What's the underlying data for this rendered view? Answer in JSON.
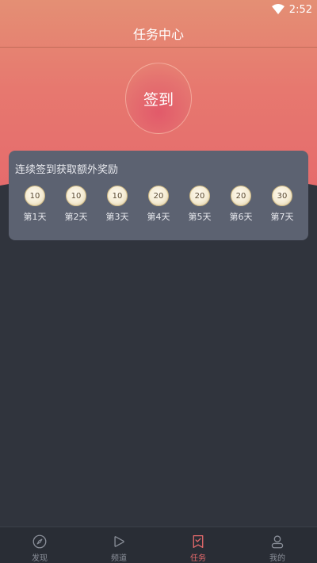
{
  "status_bar": {
    "time": "2:52"
  },
  "header": {
    "title": "任务中心"
  },
  "checkin": {
    "button_label": "签到"
  },
  "card": {
    "title": "连续签到获取额外奖励",
    "days": [
      {
        "reward": "10",
        "label": "第1天"
      },
      {
        "reward": "10",
        "label": "第2天"
      },
      {
        "reward": "10",
        "label": "第3天"
      },
      {
        "reward": "20",
        "label": "第4天"
      },
      {
        "reward": "20",
        "label": "第5天"
      },
      {
        "reward": "20",
        "label": "第6天"
      },
      {
        "reward": "30",
        "label": "第7天"
      }
    ]
  },
  "bottom_nav": {
    "items": [
      {
        "label": "发现",
        "icon": "compass-icon",
        "active": false
      },
      {
        "label": "频道",
        "icon": "play-icon",
        "active": false
      },
      {
        "label": "任务",
        "icon": "task-check-icon",
        "active": true
      },
      {
        "label": "我的",
        "icon": "profile-icon",
        "active": false
      }
    ]
  },
  "colors": {
    "accent": "#e56a6c",
    "background": "#30343d",
    "card": "#5c6271"
  }
}
